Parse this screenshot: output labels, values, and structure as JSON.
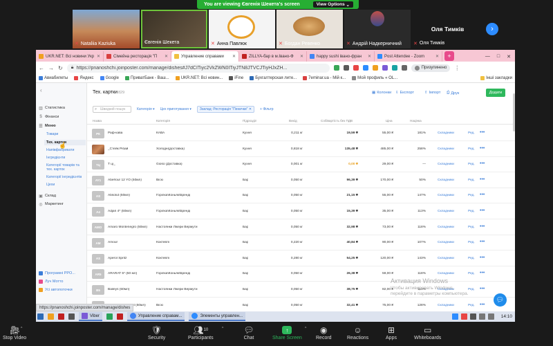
{
  "zoom": {
    "share_banner": "You are viewing Євгенія Шекета's screen",
    "view_options": "View Options",
    "participants": [
      {
        "name": "Nataliia Kaziuka"
      },
      {
        "name": "Євгенія Шекета"
      },
      {
        "name": "Анна Павлюк"
      },
      {
        "name": "Богдан Ревенко"
      },
      {
        "name": "Андрій Надкерничний"
      },
      {
        "name": "Оля Тимків"
      }
    ],
    "name_only_tile": "Оля Тимків",
    "next_arrow": "›",
    "toolbar": {
      "stop_video": "Stop Video",
      "security": "Security",
      "participants": "Participants",
      "participants_count": "10",
      "chat": "Chat",
      "share_screen": "Share Screen",
      "record": "Record",
      "reactions": "Reactions",
      "apps": "Apps",
      "whiteboards": "Whiteboards"
    }
  },
  "browser": {
    "tabs": [
      {
        "label": "UKR.NET: Всі новини Укр",
        "color": "#f0a020"
      },
      {
        "label": "Сімейна ресторація \"П",
        "color": "#d94040"
      },
      {
        "label": "Управление справами",
        "color": "#f0c040",
        "active": true
      },
      {
        "label": "ZILLYA-бар в м.Івано-Ф",
        "color": "#c02020"
      },
      {
        "label": "happy sushi івано-фран",
        "color": "#4285f4"
      },
      {
        "label": "Post Attendee - Zoom",
        "color": "#2d8cff"
      }
    ],
    "url": "https://pnanoshchi.joinposter.com/manage/dishes#J7dCITiyc2VkZWN0ITiyJTN8JTVCJTiyHJxZH...",
    "profile": "Призупинено",
    "bookmarks": [
      "Авиабилеты",
      "Яндекс",
      "Google",
      "ПриватБанк - Ваш...",
      "UKR.NET: Всі новин...",
      "iFine",
      "Бухгалтерская лите...",
      "7eminar.ua - Мій к...",
      "Мой профиль « OL..."
    ],
    "other_bookmarks": "Інші закладки",
    "status_url": "https://pnanoshchi.joinposter.com/manage/dishes"
  },
  "sidebar": {
    "items": [
      {
        "icon": "▥",
        "label": "Статистика"
      },
      {
        "icon": "$",
        "label": "Фінанси"
      },
      {
        "icon": "☰",
        "label": "Меню"
      }
    ],
    "menu_sub": [
      "Товари",
      "Тех. картки",
      "Напівфабрикати",
      "Інгредієнти",
      "Категорії товарів та тех. карток",
      "Категорії інгредієнтів",
      "Цехи"
    ],
    "bottom": [
      {
        "icon": "▣",
        "label": "Склад"
      },
      {
        "icon": "◎",
        "label": "Маркетинг"
      }
    ],
    "footer": [
      "Програмні РРО...",
      "Луч Мотто",
      "Усі автопоточки"
    ]
  },
  "main": {
    "title": "Тех. картки",
    "count": "829",
    "tools": [
      "Колонки",
      "Експорт",
      "Друк",
      "Імпорт",
      "Друк"
    ],
    "tool_labels": [
      "Колонки",
      "Експорт",
      "Імпорт",
      "Друк"
    ],
    "add": "Додати",
    "search_placeholder": "Швидкий пошук",
    "filters": [
      "Категорія",
      "Цех приготування"
    ],
    "chip": "Заклад: Ресторація \"Пенички\"",
    "more_filter": "+ Фільтр",
    "columns": [
      "Назва",
      "Категорія",
      "Підрозділ",
      "Вихід",
      "Собівартість без ПДВ",
      "Ціна",
      "Націнка"
    ],
    "rows": [
      {
        "thumb": "РК",
        "name": "Раф-кава",
        "cat": "КАВА",
        "wh": "Кухня",
        "out": "0,211 кг",
        "cost": "19,59 ₴",
        "price": "55,00 ₴",
        "mark": "181%",
        "photo": false
      },
      {
        "thumb": "",
        "name": "_Стейк Рібай",
        "cat": "Холодні(доставка)",
        "wh": "Кухня",
        "out": "0,818 кг",
        "cost": "135,48 ₴",
        "price": "485,00 ₴",
        "mark": "258%",
        "photo": true
      },
      {
        "thumb": "ТЦ",
        "name": "Т ці_",
        "cat": "Gioso (Доставка)",
        "wh": "Кухня",
        "out": "0,001 кг",
        "cost": "0,00 ₴",
        "price": "29,00 ₴",
        "mark": "—",
        "photo": false
      },
      {
        "thumb": "AY1",
        "name": "Aberlour 12 YO (50мл)",
        "cat": "Віскі",
        "wh": "Бар",
        "out": "0,050 кг",
        "cost": "96,39 ₴",
        "price": "170,00 ₴",
        "mark": "50%",
        "photo": false
      },
      {
        "thumb": "AS",
        "name": "Absolut (50мл)",
        "cat": "Горілка\\Коньяк\\Бренді",
        "wh": "Бар",
        "out": "0,050 кг",
        "cost": "21,15 ₴",
        "price": "55,00 ₴",
        "mark": "147%",
        "photo": false
      },
      {
        "thumb": "A4",
        "name": "Adjari 4* (50мл)",
        "cat": "Горілка\\Коньяк\\Бренді",
        "wh": "Бар",
        "out": "0,050 кг",
        "cost": "15,39 ₴",
        "price": "35,00 ₴",
        "mark": "113%",
        "photo": false
      },
      {
        "thumb": "AMO",
        "name": "Amaro Montenegro (50мл)",
        "cat": "Настоянки Лікери Вермути",
        "wh": "Бар",
        "out": "0,050 кг",
        "cost": "32,98 ₴",
        "price": "73,00 ₴",
        "mark": "118%",
        "photo": false
      },
      {
        "thumb": "AM",
        "name": "Amour",
        "cat": "Коктейлі",
        "wh": "Бар",
        "out": "0,220 кг",
        "cost": "40,84 ₴",
        "price": "90,00 ₴",
        "mark": "107%",
        "photo": false
      },
      {
        "thumb": "AS",
        "name": "Aperol Spritz",
        "cat": "Коктейлі",
        "wh": "Бар",
        "out": "0,280 кг",
        "cost": "54,25 ₴",
        "price": "120,00 ₴",
        "mark": "143%",
        "photo": false
      },
      {
        "thumb": "AR5",
        "name": "ARARAT 5* (50 мл)",
        "cat": "Горілка\\Коньяк\\Бренді",
        "wh": "Бар",
        "out": "0,050 кг",
        "cost": "26,38 ₴",
        "price": "59,00 ₴",
        "mark": "118%",
        "photo": false
      },
      {
        "thumb": "B5",
        "name": "Baileys (50мл)",
        "cat": "Настоянки Лікери Вермути",
        "wh": "Бар",
        "out": "0,050 кг",
        "cost": "38,75 ₴",
        "price": "82,00 ₴",
        "mark": "113%",
        "photo": false
      },
      {
        "thumb": "BF5",
        "name": "Ballantine's Finest (50мл)",
        "cat": "Віскі",
        "wh": "Бар",
        "out": "0,050 кг",
        "cost": "32,41 ₴",
        "price": "75,00 ₴",
        "mark": "128%",
        "photo": false
      }
    ],
    "row_actions": {
      "composition": "Складники",
      "edit": "Ред.",
      "more": "•••"
    }
  },
  "watermark": {
    "line1": "Активация Windows",
    "line2": "Чтобы активировать Windows, перейдите в параметры компьютера."
  },
  "taskbar": {
    "apps": [
      "Viber",
      "Управление справам...",
      "Элементы управлен..."
    ],
    "time": "14:10"
  },
  "colors": {
    "accent": "#3b7dd8",
    "add_button": "#2eb85c",
    "zoom_green": "#27ae33",
    "tab_bar": "#f7c7d4"
  }
}
